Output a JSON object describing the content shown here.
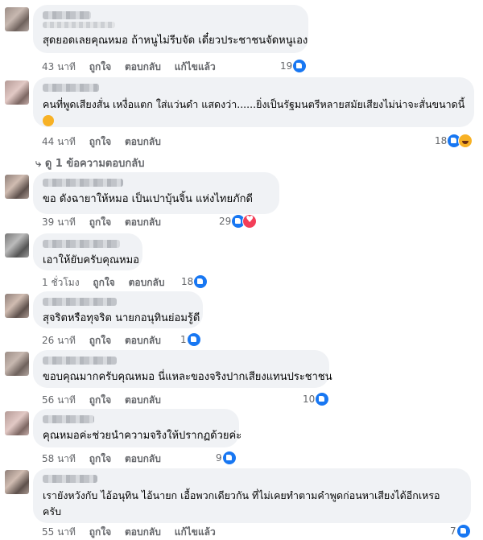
{
  "comments": [
    {
      "text": [
        "สุดยอดเลยคุณหมอ ถ้าหนูไม่รีบจัด เดี๋ยวประชาชนจัดหนูเอง"
      ],
      "time": "43 นาที",
      "like": "ถูกใจ",
      "reply": "ตอบกลับ",
      "edited": "แก้ไขแล้ว",
      "count": "19",
      "reactions": [
        "like"
      ]
    },
    {
      "text": [
        "คนที่พูดเสียงสั่น เหงื่อแตก ใส่แว่นดำ แสดงว่า......ยิ่งเป็นรัฐมนตรีหลายสมัยเสียงไม่น่าจะสั่นขนาดนี้"
      ],
      "time": "44 นาที",
      "like": "ถูกใจ",
      "reply": "ตอบกลับ",
      "count": "18",
      "reactions": [
        "like",
        "haha"
      ]
    },
    {
      "text": [
        "ขอ ดังฉายาให้หมอ เป็นเปาบุ้นจิ้น แห่งไทยภักดี"
      ],
      "time": "39 นาที",
      "like": "ถูกใจ",
      "reply": "ตอบกลับ",
      "count": "29",
      "reactions": [
        "like",
        "love"
      ]
    },
    {
      "text": [
        "เอาให้ยับครับคุณหมอ"
      ],
      "time": "1 ชั่วโมง",
      "like": "ถูกใจ",
      "reply": "ตอบกลับ",
      "count": "18",
      "reactions": [
        "like"
      ]
    },
    {
      "text": [
        "สุจริตหรือทุจริต นายกอนุทินย่อมรู้ดี"
      ],
      "time": "26 นาที",
      "like": "ถูกใจ",
      "reply": "ตอบกลับ",
      "count": "1",
      "reactions": [
        "like"
      ]
    },
    {
      "text": [
        "ขอบคุณมากครับคุณหมอ นี่แหละของจริงปากเสียงแทนประชาชน"
      ],
      "time": "56 นาที",
      "like": "ถูกใจ",
      "reply": "ตอบกลับ",
      "count": "10",
      "reactions": [
        "like"
      ]
    },
    {
      "text": [
        "คุณหมอค่ะช่วยนำความจริงให้ปรากฏด้วยค่ะ"
      ],
      "time": "58 นาที",
      "like": "ถูกใจ",
      "reply": "ตอบกลับ",
      "count": "9",
      "reactions": [
        "like"
      ]
    },
    {
      "text": [
        "เรายังหวังกับ ไอ้อนุทิน ไอ้นายก เอื้อพวกเดียวกัน ที่ไม่เคยทำตามคำพูดก่อนหาเสียงได้อีกเหรอ",
        "ครับ"
      ],
      "time": "55 นาที",
      "like": "ถูกใจ",
      "reply": "ตอบกลับ",
      "edited": "แก้ไขแล้ว",
      "count": "7",
      "reactions": [
        "like"
      ]
    }
  ],
  "view_replies": "ดู 1 ข้อความตอบกลับ",
  "colors": {
    "bubble": "#f0f2f5",
    "like_blue": "#1877f2",
    "meta_gray": "#65676b"
  }
}
